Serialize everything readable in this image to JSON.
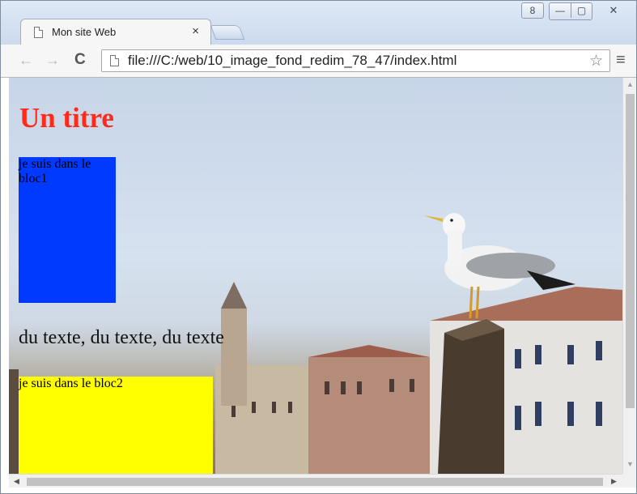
{
  "window": {
    "controls": {
      "user": "8",
      "minimize": "—",
      "maximize": "▢",
      "close": "✕"
    }
  },
  "tabs": [
    {
      "title": "Mon site Web",
      "close": "×"
    }
  ],
  "toolbar": {
    "back": "←",
    "forward": "→",
    "reload": "C",
    "url": "file:///C:/web/10_image_fond_redim_78_47/index.html",
    "bookmark_icon": "star-icon",
    "menu_icon": "menu-icon",
    "menu": "≡",
    "star": "☆"
  },
  "page": {
    "title": "Un titre",
    "bloc1_text": "je suis dans le bloc1",
    "body_text": "du texte, du texte, du texte",
    "bloc2_text": "je suis dans le bloc2"
  },
  "colors": {
    "title": "#ff2a1a",
    "bloc1": "#0039ff",
    "bloc2": "#ffff00"
  },
  "scrollbars": {
    "up": "▲",
    "down": "▼",
    "left": "◀",
    "right": "▶"
  }
}
